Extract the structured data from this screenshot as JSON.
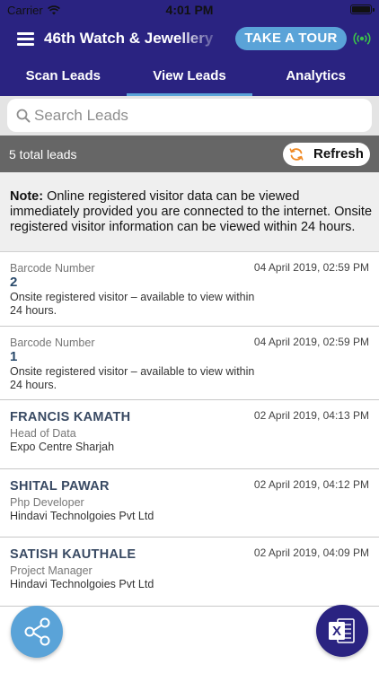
{
  "status_bar": {
    "carrier": "Carrier",
    "time": "4:01 PM"
  },
  "app_bar": {
    "title": "46th Watch & Jewellery",
    "tour_button": "TAKE A TOUR"
  },
  "tabs": [
    {
      "label": "Scan Leads",
      "active": false
    },
    {
      "label": "View Leads",
      "active": true
    },
    {
      "label": "Analytics",
      "active": false
    }
  ],
  "search": {
    "placeholder": "Search Leads",
    "value": ""
  },
  "count_bar": {
    "total": "5 total leads",
    "refresh_label": "Refresh"
  },
  "note": {
    "prefix": "Note:",
    "text": " Online registered visitor data can be viewed immediately provided you are connected to the internet. Onsite registered visitor information can be viewed within 24 hours."
  },
  "leads": [
    {
      "kind": "barcode",
      "label": "Barcode Number",
      "barcode": "2",
      "date": "04 April 2019, 02:59 PM",
      "line1": "Onsite registered visitor – available to view within",
      "line2": "24 hours."
    },
    {
      "kind": "barcode",
      "label": "Barcode Number",
      "barcode": "1",
      "date": "04 April 2019, 02:59 PM",
      "line1": "Onsite registered visitor – available to view within",
      "line2": "24 hours."
    },
    {
      "kind": "person",
      "name": "FRANCIS KAMATH",
      "role": "Head of Data",
      "company": "Expo Centre Sharjah",
      "date": "02 April 2019, 04:13 PM"
    },
    {
      "kind": "person",
      "name": "SHITAL PAWAR",
      "role": "Php Developer",
      "company": "Hindavi Technolgoies Pvt Ltd",
      "date": "02 April 2019, 04:12 PM"
    },
    {
      "kind": "person",
      "name": "SATISH KAUTHALE",
      "role": "Project Manager",
      "company": "Hindavi Technolgoies Pvt Ltd",
      "date": "02 April 2019, 04:09 PM"
    }
  ],
  "fabs": {
    "share_icon": "share-icon",
    "excel_icon": "excel-icon",
    "excel_letter": "X"
  },
  "colors": {
    "primary": "#2a2381",
    "accent": "#5aa3d8",
    "count_bar": "#666666",
    "refresh_icon": "#f08a24",
    "connected_icon": "#3cc24a"
  }
}
